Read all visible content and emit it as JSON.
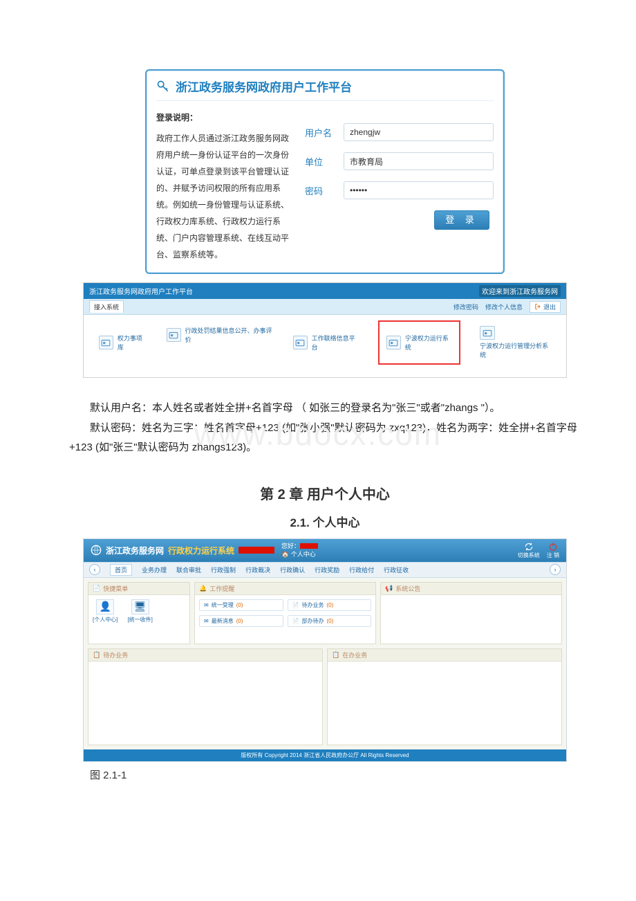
{
  "login_panel": {
    "title": "浙江政务服务网政府用户工作平台",
    "instructions_title": "登录说明：",
    "instructions_text": "政府工作人员通过浙江政务服务网政府用户统一身份认证平台的一次身份认证，可单点登录到该平台管理认证的、并赋予访问权限的所有应用系统。例如统一身份管理与认证系统、行政权力库系统、行政权力运行系统、门户内容管理系统、在线互动平台、监察系统等。",
    "username_label": "用户名",
    "username_value": "zhengjw",
    "unit_label": "单位",
    "unit_value": "市教育局",
    "password_label": "密码",
    "password_value": "••••••",
    "login_button": "登 录"
  },
  "portal": {
    "title": "浙江政务服务网政府用户工作平台",
    "welcome": "欢迎来到浙江政务服务网",
    "tab": "接入系统",
    "link_change_pw": "修改密码",
    "link_change_info": "修改个人信息",
    "link_exit": "退出",
    "apps": [
      "权力事项库",
      "行政处罚结果信息公开、办事评价",
      "工作联络信息平台",
      "宁波权力运行系统",
      "宁波权力运行管理分析系统"
    ]
  },
  "body_text": {
    "para1": "默认用户名：本人姓名或者姓全拼+名首字母 （ 如张三的登录名为\"张三\"或者\"zhangs \"）。",
    "para2": "默认密码：姓名为三字：姓名首字母+123 (如\"张小强\"默认密码为 zxq123)，姓名为两字：姓全拼+名首字母+123 (如\"张三\"默认密码为 zhangs123)。"
  },
  "chapter2": {
    "heading": "第 2 章 用户个人中心",
    "section": "2.1. 个人中心"
  },
  "system": {
    "brand1": "浙江政务服务网",
    "brand2": "行政权力运行系统",
    "hello": "您好：",
    "personal_center": "个人中心",
    "switch_system": "切换系统",
    "logout": "注 销",
    "nav": {
      "home": "首页",
      "items": [
        "业务办理",
        "联合审批",
        "行政强制",
        "行政裁决",
        "行政确认",
        "行政奖励",
        "行政给付",
        "行政征收"
      ]
    },
    "panels": {
      "quick_menu": "快捷菜单",
      "quick_items": [
        "[个人中心]",
        "[统一收件]"
      ],
      "work_remind": "工作提醒",
      "work_items": [
        {
          "label": "统一受理",
          "count": "(0)"
        },
        {
          "label": "待办业务",
          "count": "(0)"
        },
        {
          "label": "最新消息",
          "count": "(0)"
        },
        {
          "label": "部办待办",
          "count": "(0)"
        }
      ],
      "sys_notice": "系统公告",
      "pending": "待办业务",
      "inprogress": "在办业务"
    },
    "footer": "版权所有 Copyright 2014 浙江省人民政府办公厅 All Rights Reserved"
  },
  "figure_caption": "图 2.1-1",
  "watermark": "www.bdocx.com"
}
